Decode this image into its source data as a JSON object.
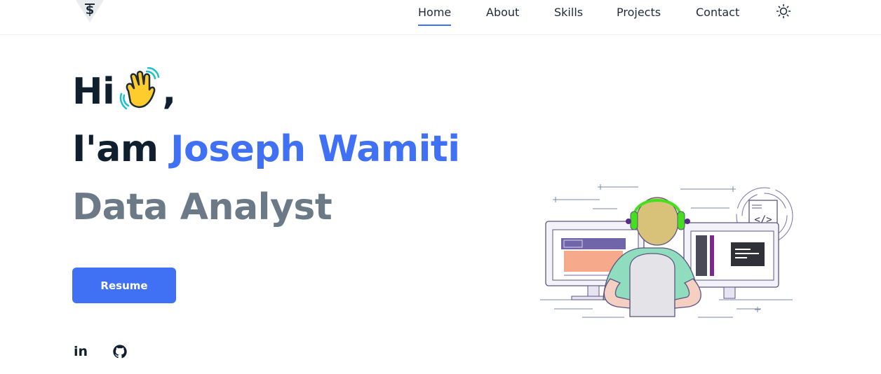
{
  "header": {
    "logo_icon": "dollar-s-logo",
    "nav": [
      {
        "label": "Home",
        "active": true
      },
      {
        "label": "About",
        "active": false
      },
      {
        "label": "Skills",
        "active": false
      },
      {
        "label": "Projects",
        "active": false
      },
      {
        "label": "Contact",
        "active": false
      }
    ],
    "theme_icon": "sun-icon"
  },
  "hero": {
    "greeting": "Hi",
    "greeting_emoji": "waving-hand",
    "greeting_suffix": ",",
    "intro_prefix": "I'am",
    "name": "Joseph Wamiti",
    "role": "Data Analyst",
    "resume_label": "Resume"
  },
  "social": {
    "linkedin_label": "in",
    "github_icon": "github-icon"
  },
  "colors": {
    "accent": "#4070f4",
    "heading": "#0f1f2e",
    "role": "#6b7a86",
    "headphones": "#44e01e"
  },
  "illustration": "developer-at-dual-monitors"
}
